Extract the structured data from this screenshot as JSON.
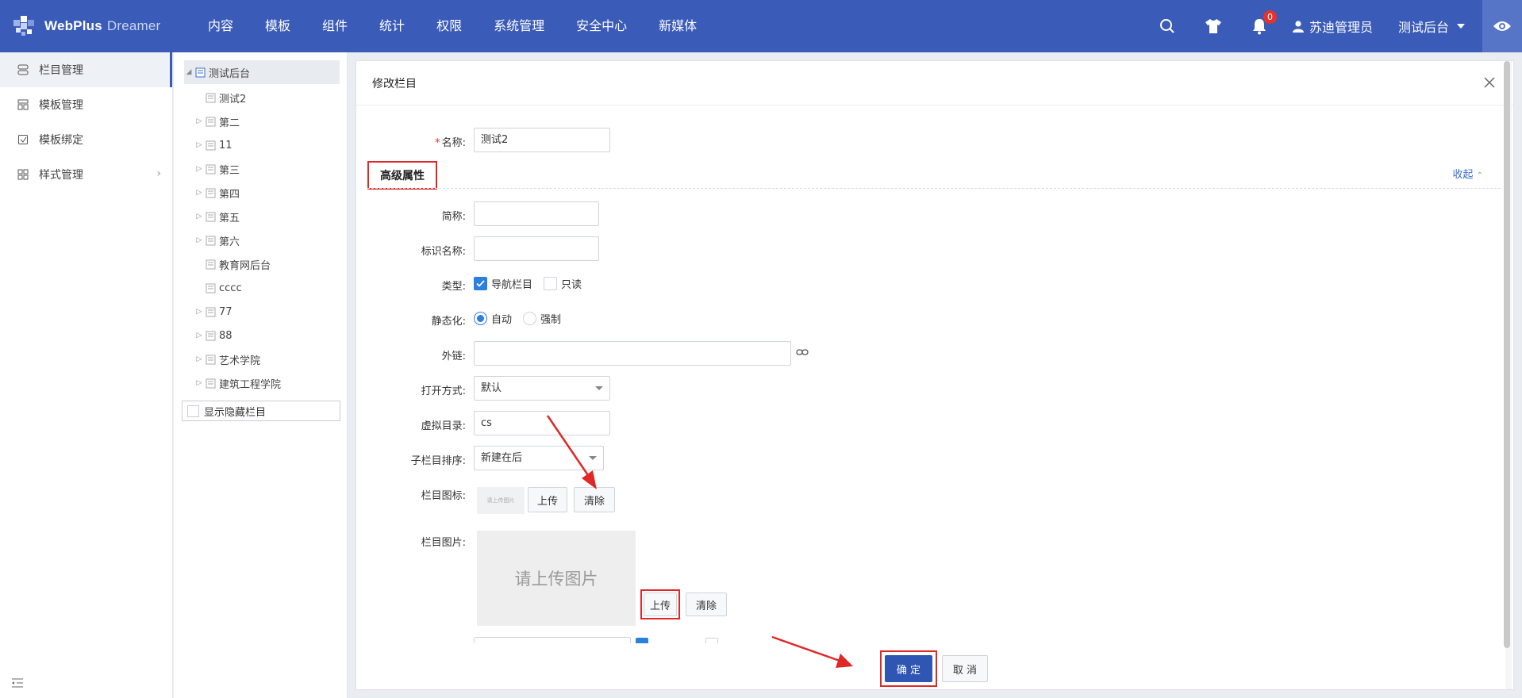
{
  "brand": {
    "name": "WebPlus",
    "sub": "Dreamer"
  },
  "nav": [
    "内容",
    "模板",
    "组件",
    "统计",
    "权限",
    "系统管理",
    "安全中心",
    "新媒体"
  ],
  "header": {
    "notifications": "0",
    "user": "苏迪管理员",
    "site": "测试后台"
  },
  "sidebar": {
    "items": [
      {
        "label": "栏目管理",
        "icon": "column-icon"
      },
      {
        "label": "模板管理",
        "icon": "template-icon"
      },
      {
        "label": "模板绑定",
        "icon": "bind-icon"
      },
      {
        "label": "样式管理",
        "icon": "style-icon"
      }
    ]
  },
  "tree": {
    "root": "测试后台",
    "children": [
      "测试2",
      "第二",
      "11",
      "第三",
      "第四",
      "第五",
      "第六",
      "教育网后台",
      "cccc",
      "77",
      "88",
      "艺术学院",
      "建筑工程学院"
    ],
    "show_hidden": "显示隐藏栏目"
  },
  "dialog": {
    "title": "修改栏目",
    "name_label": "名称:",
    "name_value": "测试2",
    "advanced": "高级属性",
    "collapse": "收起",
    "short_label": "简称:",
    "ident_label": "标识名称:",
    "type_label": "类型:",
    "type_nav": "导航栏目",
    "type_readonly": "只读",
    "static_label": "静态化:",
    "static_auto": "自动",
    "static_force": "强制",
    "link_label": "外链:",
    "open_label": "打开方式:",
    "open_value": "默认",
    "vdir_label": "虚拟目录:",
    "vdir_value": "cs",
    "sort_label": "子栏目排序:",
    "sort_value": "新建在后",
    "icon_label": "栏目图标:",
    "icon_placeholder": "请上传图片",
    "upload": "上传",
    "clear": "清除",
    "img_label": "栏目图片:",
    "img_placeholder": "请上传图片",
    "ok": "确 定",
    "cancel": "取 消"
  },
  "colors": {
    "topbar": "#3a5bb8",
    "accent": "#2b7fe0",
    "annotation": "#e02828"
  }
}
